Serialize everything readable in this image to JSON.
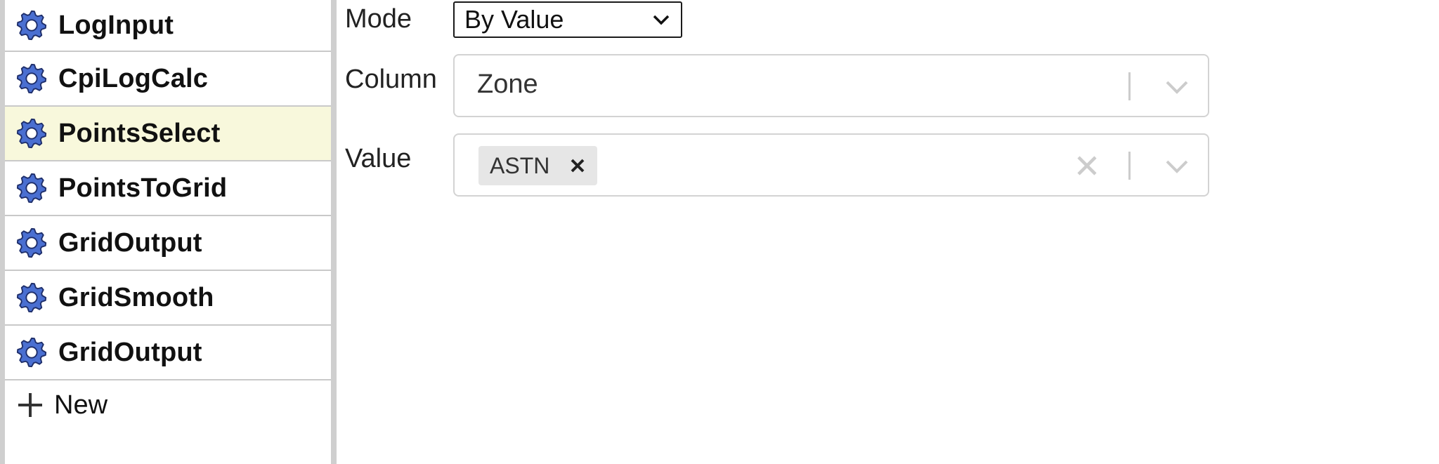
{
  "sidebar": {
    "items": [
      {
        "label": "LogInput",
        "icon": "gear-icon",
        "selected": false
      },
      {
        "label": "CpiLogCalc",
        "icon": "gear-icon",
        "selected": false
      },
      {
        "label": "PointsSelect",
        "icon": "gear-icon",
        "selected": true
      },
      {
        "label": "PointsToGrid",
        "icon": "gear-icon",
        "selected": false
      },
      {
        "label": "GridOutput",
        "icon": "gear-icon",
        "selected": false
      },
      {
        "label": "GridSmooth",
        "icon": "gear-icon",
        "selected": false
      },
      {
        "label": "GridOutput",
        "icon": "gear-icon",
        "selected": false
      }
    ],
    "new_label": "New",
    "selected_color": "#f8f8dc",
    "gear_color": "#4a6fd1"
  },
  "form": {
    "mode": {
      "label": "Mode",
      "value": "By Value"
    },
    "column": {
      "label": "Column",
      "value": "Zone"
    },
    "value": {
      "label": "Value",
      "chips": [
        "ASTN"
      ]
    }
  }
}
